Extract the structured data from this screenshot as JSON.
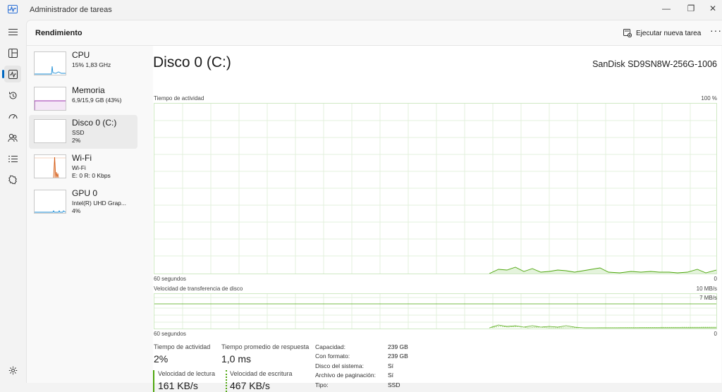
{
  "window": {
    "title": "Administrador de tareas",
    "minimize": "—",
    "maximize": "❐",
    "close": "✕"
  },
  "nav": {
    "items": [
      {
        "icon": "hamburger-icon"
      },
      {
        "icon": "processes-icon"
      },
      {
        "icon": "performance-icon"
      },
      {
        "icon": "app-history-icon"
      },
      {
        "icon": "startup-apps-icon"
      },
      {
        "icon": "users-icon"
      },
      {
        "icon": "details-icon"
      },
      {
        "icon": "services-icon"
      },
      {
        "icon": "settings-icon"
      }
    ]
  },
  "header": {
    "title": "Rendimiento",
    "run_task": "Ejecutar nueva tarea",
    "more": "···"
  },
  "sidebar": {
    "items": [
      {
        "name": "CPU",
        "sub": "15% 1,83 GHz",
        "sub2": ""
      },
      {
        "name": "Memoria",
        "sub": "6,9/15,9 GB (43%)",
        "sub2": ""
      },
      {
        "name": "Disco 0 (C:)",
        "sub": "SSD",
        "sub2": "2%"
      },
      {
        "name": "Wi-Fi",
        "sub": "Wi-Fi",
        "sub2": "E: 0 R: 0 Kbps"
      },
      {
        "name": "GPU 0",
        "sub": "Intel(R) UHD Grap...",
        "sub2": "4%"
      }
    ]
  },
  "main": {
    "title": "Disco 0 (C:)",
    "model": "SanDisk SD9SN8W-256G-1006",
    "graph1": {
      "label": "Tiempo de actividad",
      "max": "100 %",
      "time": "60 segundos",
      "min": "0"
    },
    "graph2": {
      "label": "Velocidad de transferencia de disco",
      "max": "10 MB/s",
      "mid": "7 MB/s",
      "time": "60 segundos",
      "min": "0"
    },
    "stats": {
      "activity_label": "Tiempo de actividad",
      "activity_value": "2%",
      "response_label": "Tiempo promedio de respuesta",
      "response_value": "1,0 ms",
      "read_label": "Velocidad de lectura",
      "read_value": "161 KB/s",
      "write_label": "Velocidad de escritura",
      "write_value": "467 KB/s"
    },
    "props": [
      {
        "label": "Capacidad:",
        "value": "239 GB"
      },
      {
        "label": "Con formato:",
        "value": "239 GB"
      },
      {
        "label": "Disco del sistema:",
        "value": "Sí"
      },
      {
        "label": "Archivo de paginación:",
        "value": "Sí"
      },
      {
        "label": "Tipo:",
        "value": "SSD"
      }
    ]
  },
  "colors": {
    "disk": "#4da60c",
    "cpu": "#1b8dd6",
    "memory": "#9b2fae",
    "wifi": "#d45a13",
    "gpu": "#1b8dd6"
  }
}
